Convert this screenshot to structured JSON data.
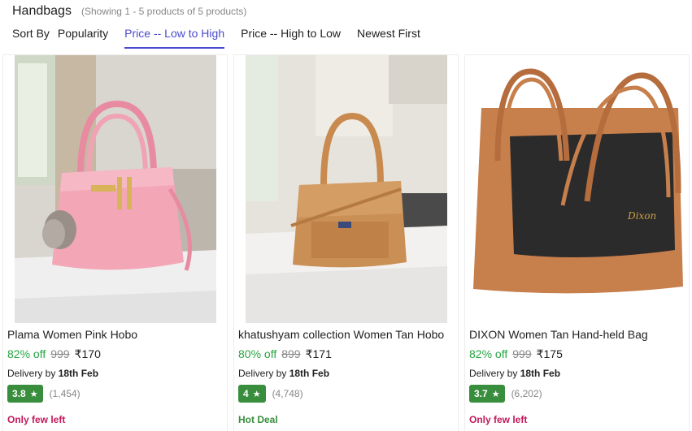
{
  "header": {
    "title": "Handbags",
    "showing": "(Showing 1 - 5 products of 5 products)"
  },
  "sort": {
    "label": "Sort By",
    "options": [
      "Popularity",
      "Price -- Low to High",
      "Price -- High to Low",
      "Newest First"
    ],
    "active": "Price -- Low to High"
  },
  "products": [
    {
      "name": "Plama Women Pink Hobo",
      "discount": "82% off",
      "mrp": "999",
      "price": "₹170",
      "delivery_prefix": "Delivery by",
      "delivery_date": "18th Feb",
      "rating": "3.8",
      "rating_count": "(1,454)",
      "tag": "Only few left",
      "tag_color": "#c2185b",
      "image_icon": "pink-handbag-image"
    },
    {
      "name": "khatushyam collection Women Tan Hobo",
      "discount": "80% off",
      "mrp": "899",
      "price": "₹171",
      "delivery_prefix": "Delivery by",
      "delivery_date": "18th Feb",
      "rating": "4",
      "rating_count": "(4,748)",
      "tag": "Hot Deal",
      "tag_color": "#388e3c",
      "image_icon": "tan-handbag-image"
    },
    {
      "name": "DIXON Women Tan Hand-held Bag",
      "discount": "82% off",
      "mrp": "999",
      "price": "₹175",
      "delivery_prefix": "Delivery by",
      "delivery_date": "18th Feb",
      "rating": "3.7",
      "rating_count": "(6,202)",
      "tag": "Only few left",
      "tag_color": "#c2185b",
      "image_icon": "tan-black-handbag-image",
      "brand_mark": "Dixon"
    }
  ],
  "colors": {
    "accent": "#4a4ad0",
    "discount": "#26a541",
    "rating_bg": "#388e3c"
  }
}
